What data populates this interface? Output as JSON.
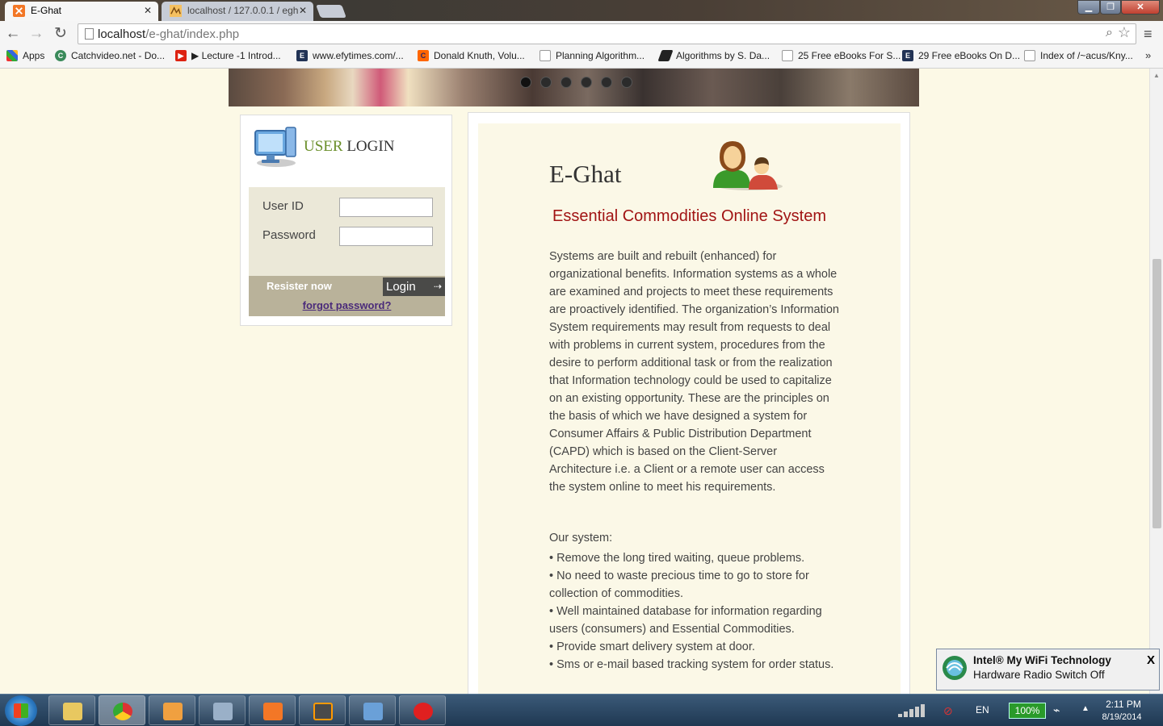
{
  "browser": {
    "tabs": [
      {
        "label": "E-Ghat",
        "active": true
      },
      {
        "label": "localhost / 127.0.0.1 / egh",
        "active": false
      }
    ],
    "url_host": "localhost",
    "url_path": "/e-ghat/index.php",
    "bookmarks": [
      {
        "label": "Apps",
        "icon": "apps-grid-icon"
      },
      {
        "label": "Catchvideo.net - Do...",
        "icon": "catchvideo-icon"
      },
      {
        "label": "▶ Lecture -1 Introd...",
        "icon": "youtube-icon"
      },
      {
        "label": "www.efytimes.com/...",
        "icon": "efy-icon"
      },
      {
        "label": "Donald Knuth, Volu...",
        "icon": "c-logo-icon"
      },
      {
        "label": "Planning Algorithm...",
        "icon": "page-icon"
      },
      {
        "label": "Algorithms by S. Da...",
        "icon": "pen-icon"
      },
      {
        "label": "25 Free eBooks For S...",
        "icon": "page-icon"
      },
      {
        "label": "29 Free eBooks On D...",
        "icon": "efy-icon"
      },
      {
        "label": "Index of /~acus/Kny...",
        "icon": "page-icon"
      }
    ],
    "bookmarks_more": "»"
  },
  "login": {
    "heading_user": "USER",
    "heading_login": " LOGIN",
    "userid_label": "User ID",
    "userid_value": "",
    "password_label": "Password",
    "password_value": "",
    "register_label": "Resister now",
    "login_button": "Login",
    "forgot_label": "forgot password?"
  },
  "content": {
    "title": "E-Ghat",
    "subtitle": "Essential Commodities Online System",
    "description": "Systems are built and rebuilt (enhanced) for organizational benefits. Information systems as a whole are examined and projects to meet these requirements are proactively identified. The organization’s Information System requirements may result from requests to deal with problems in current system, procedures from the desire to perform additional task or from the realization that Information technology could be used to capitalize on an existing opportunity. These are the principles on the basis of which we have designed a system for Consumer Affairs & Public Distribution Department (CAPD) which is based on the Client-Server Architecture i.e. a Client or a remote user can access the system online to meet his requirements.",
    "features_title": "Our system:",
    "features": [
      "Remove the long tired waiting, queue problems.",
      "No need to waste precious time to go to store for collection of commodities.",
      "Well maintained database for information regarding users (consumers) and Essential Commodities.",
      "Provide smart delivery system at door.",
      "Sms or e-mail based tracking system for order status."
    ]
  },
  "carousel": {
    "slide_count": 6,
    "active_slide": 1
  },
  "notification": {
    "title": "Intel® My WiFi Technology",
    "body": "Hardware Radio Switch Off",
    "close": "X"
  },
  "taskbar": {
    "apps": [
      "file-explorer-icon",
      "chrome-icon",
      "media-player-icon",
      "computer-icon",
      "xampp-icon",
      "sublime-text-icon",
      "control-panel-icon",
      "share-app-icon"
    ],
    "language": "EN",
    "battery": "100%",
    "time": "2:11 PM",
    "date": "8/19/2014"
  },
  "colors": {
    "page_background": "#fcf9e6",
    "subtitle": "#a11414",
    "login_accent": "#6a8f2a",
    "login_bar": "#b9b29a"
  }
}
